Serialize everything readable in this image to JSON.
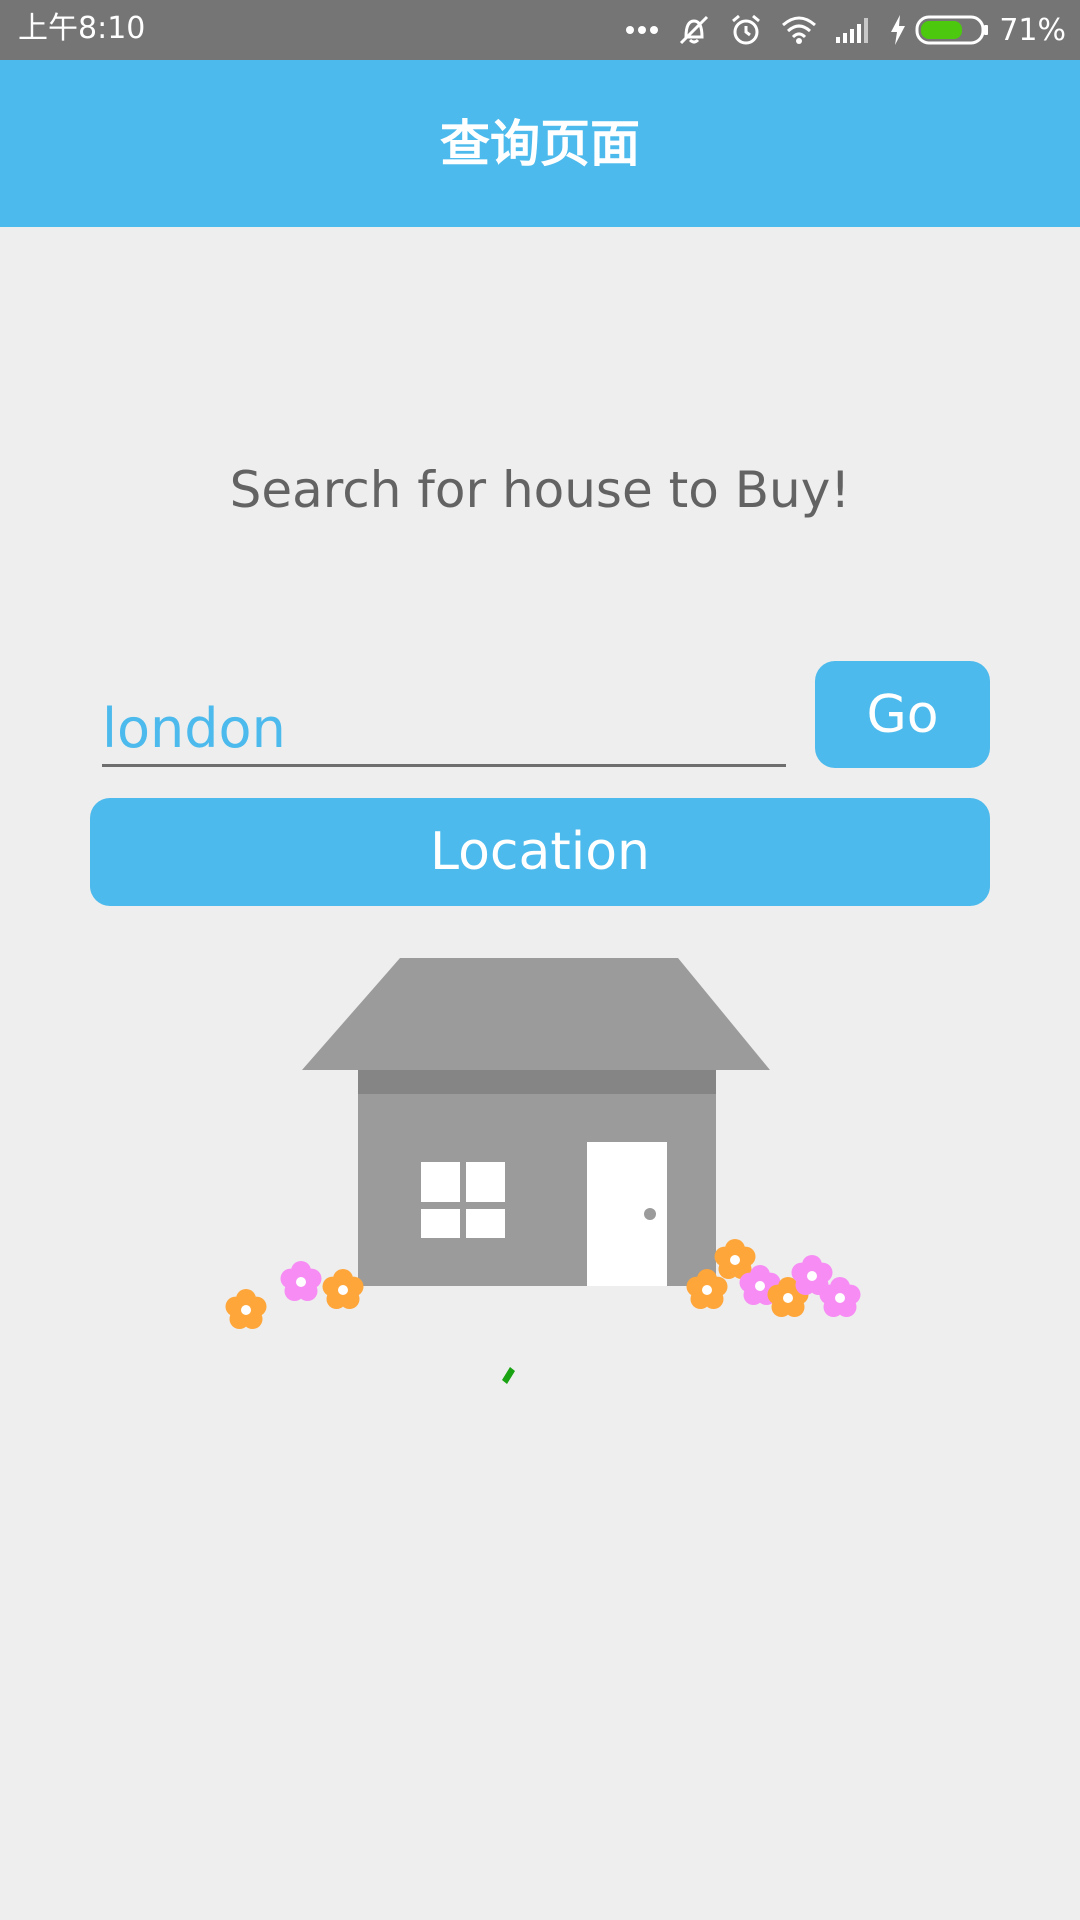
{
  "status_bar": {
    "time": "上午8:10",
    "battery_percent": "71%",
    "battery_level": 0.71,
    "icons": [
      "more-dots-icon",
      "mute-vibrate-icon",
      "alarm-icon",
      "wifi-icon",
      "cell-signal-icon",
      "charging-icon",
      "battery-icon"
    ]
  },
  "app_bar": {
    "title": "查询页面"
  },
  "main": {
    "heading": "Search for house to Buy!",
    "search": {
      "value": "london",
      "placeholder": ""
    },
    "go_label": "Go",
    "location_label": "Location"
  },
  "colors": {
    "accent": "#4cbaec",
    "status_bar": "#757575",
    "background": "#eeeeee",
    "heading_text": "#636363",
    "battery_fill": "#4cc90f"
  },
  "illustration": {
    "icon": "house-with-flowers-icon"
  }
}
